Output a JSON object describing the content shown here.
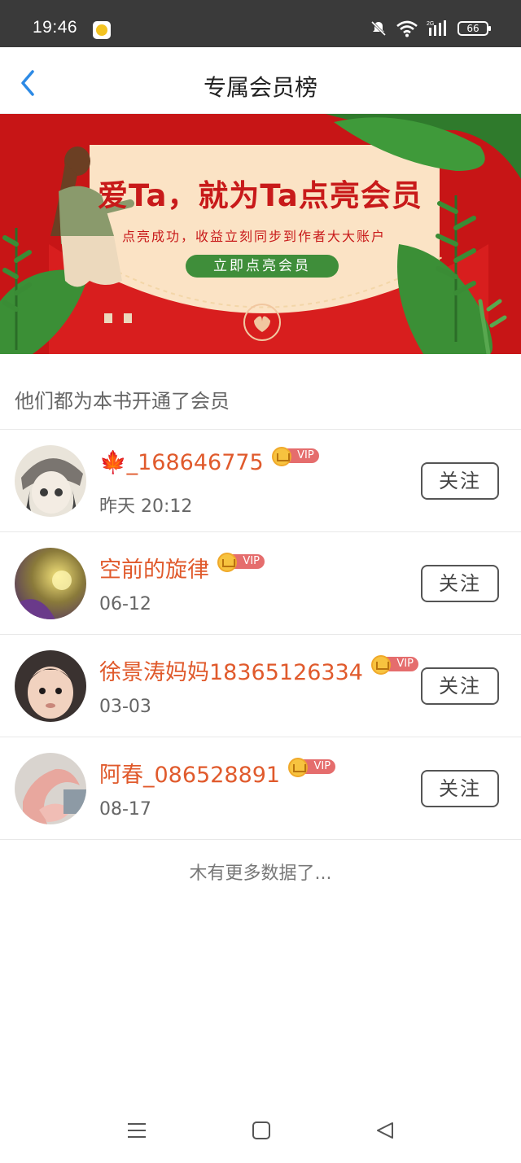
{
  "status_bar": {
    "time": "19:46",
    "battery": "66"
  },
  "header": {
    "title": "专属会员榜"
  },
  "banner": {
    "headline": "爱Ta，就为Ta点亮会员",
    "subtitle": "点亮成功，收益立刻同步到作者大大账户",
    "cta": "立即点亮会员"
  },
  "section": {
    "title": "他们都为本书开通了会员"
  },
  "members": [
    {
      "name": "🍁_168646775",
      "badge": "VIP",
      "time": "昨天 20:12",
      "follow": "关注"
    },
    {
      "name": "空前的旋律",
      "badge": "VIP",
      "time": "06-12",
      "follow": "关注"
    },
    {
      "name": "徐景涛妈妈18365126334",
      "badge": "VIP",
      "time": "03-03",
      "follow": "关注"
    },
    {
      "name": "阿春_086528891",
      "badge": "VIP",
      "time": "08-17",
      "follow": "关注"
    }
  ],
  "footer": {
    "no_more": "木有更多数据了..."
  },
  "colors": {
    "accent": "#e05a2c",
    "banner_red": "#c71516",
    "nav_blue": "#2d8ae5"
  }
}
